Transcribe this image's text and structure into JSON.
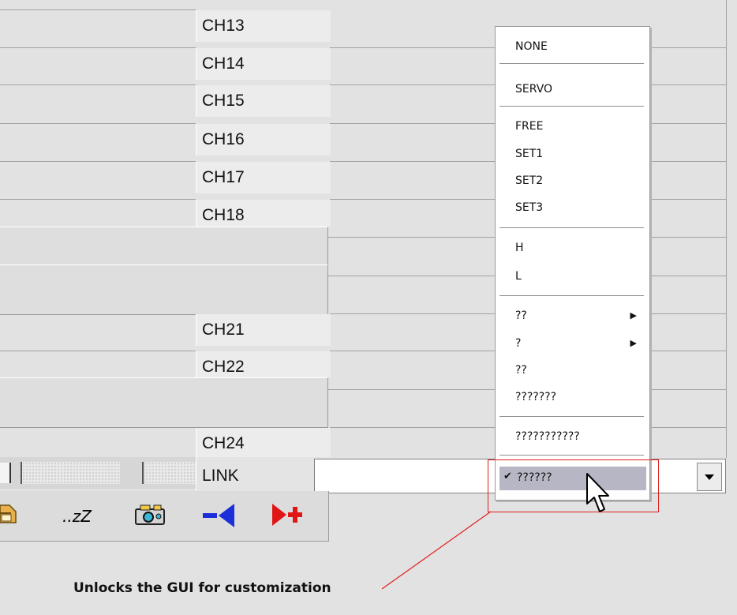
{
  "channels": {
    "ch13": "CH13",
    "ch14": "CH14",
    "ch15": "CH15",
    "ch16": "CH16",
    "ch17": "CH17",
    "ch18": "CH18",
    "ch21": "CH21",
    "ch22": "CH22",
    "ch24": "CH24",
    "link": "LINK"
  },
  "menu": {
    "none": "NONE",
    "servo": "SERVO",
    "free": "FREE",
    "set1": "SET1",
    "set2": "SET2",
    "set3": "SET3",
    "h": "H",
    "l": "L",
    "q2a": "??",
    "q1": "?",
    "q2b": "??",
    "q7": "???????",
    "q11": "???????????",
    "q6": "??????"
  },
  "link_select": {
    "value": ""
  },
  "toolbar": {
    "sleep": "..zZ"
  },
  "annotation": {
    "text": "Unlocks the GUI for customization",
    "color": "#e02020"
  },
  "icons": [
    "home-icon",
    "sleep-icon",
    "camera-icon",
    "remove-icon",
    "add-icon",
    "checkmark-icon",
    "submenu-arrow-icon",
    "cursor-icon",
    "dropdown-arrow-icon"
  ]
}
